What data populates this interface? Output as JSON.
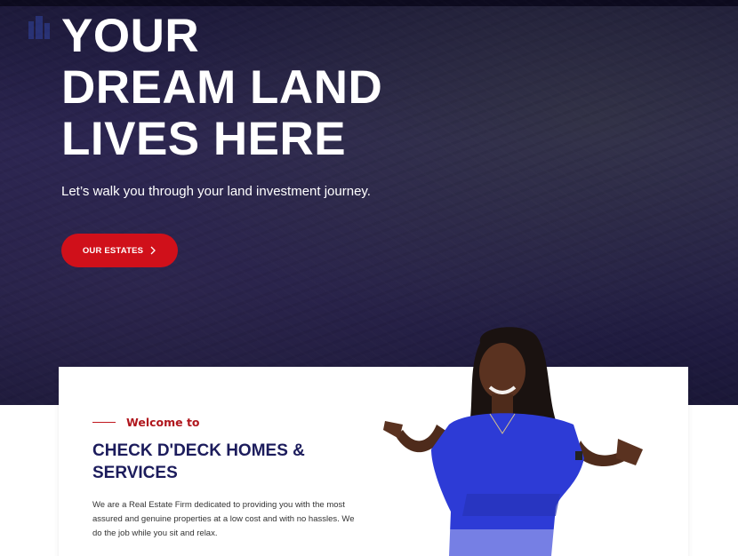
{
  "hero": {
    "title_line1": "YOUR",
    "title_line2": "DREAM LAND",
    "title_line3": "LIVES HERE",
    "subtitle": "Let’s walk you through your land investment journey.",
    "cta_label": "OUR ESTATES",
    "cta_color": "#d0101a"
  },
  "about": {
    "eyebrow": "Welcome to",
    "heading": "CHECK D'DECK HOMES & SERVICES",
    "paragraph": "We are a Real Estate Firm dedicated to providing you with the most assured and genuine properties at a low cost and with no hassles. We do the job while you sit and relax."
  },
  "colors": {
    "accent": "#d0101a",
    "heading": "#1c1c5c",
    "hero_bg": "#241f47"
  }
}
